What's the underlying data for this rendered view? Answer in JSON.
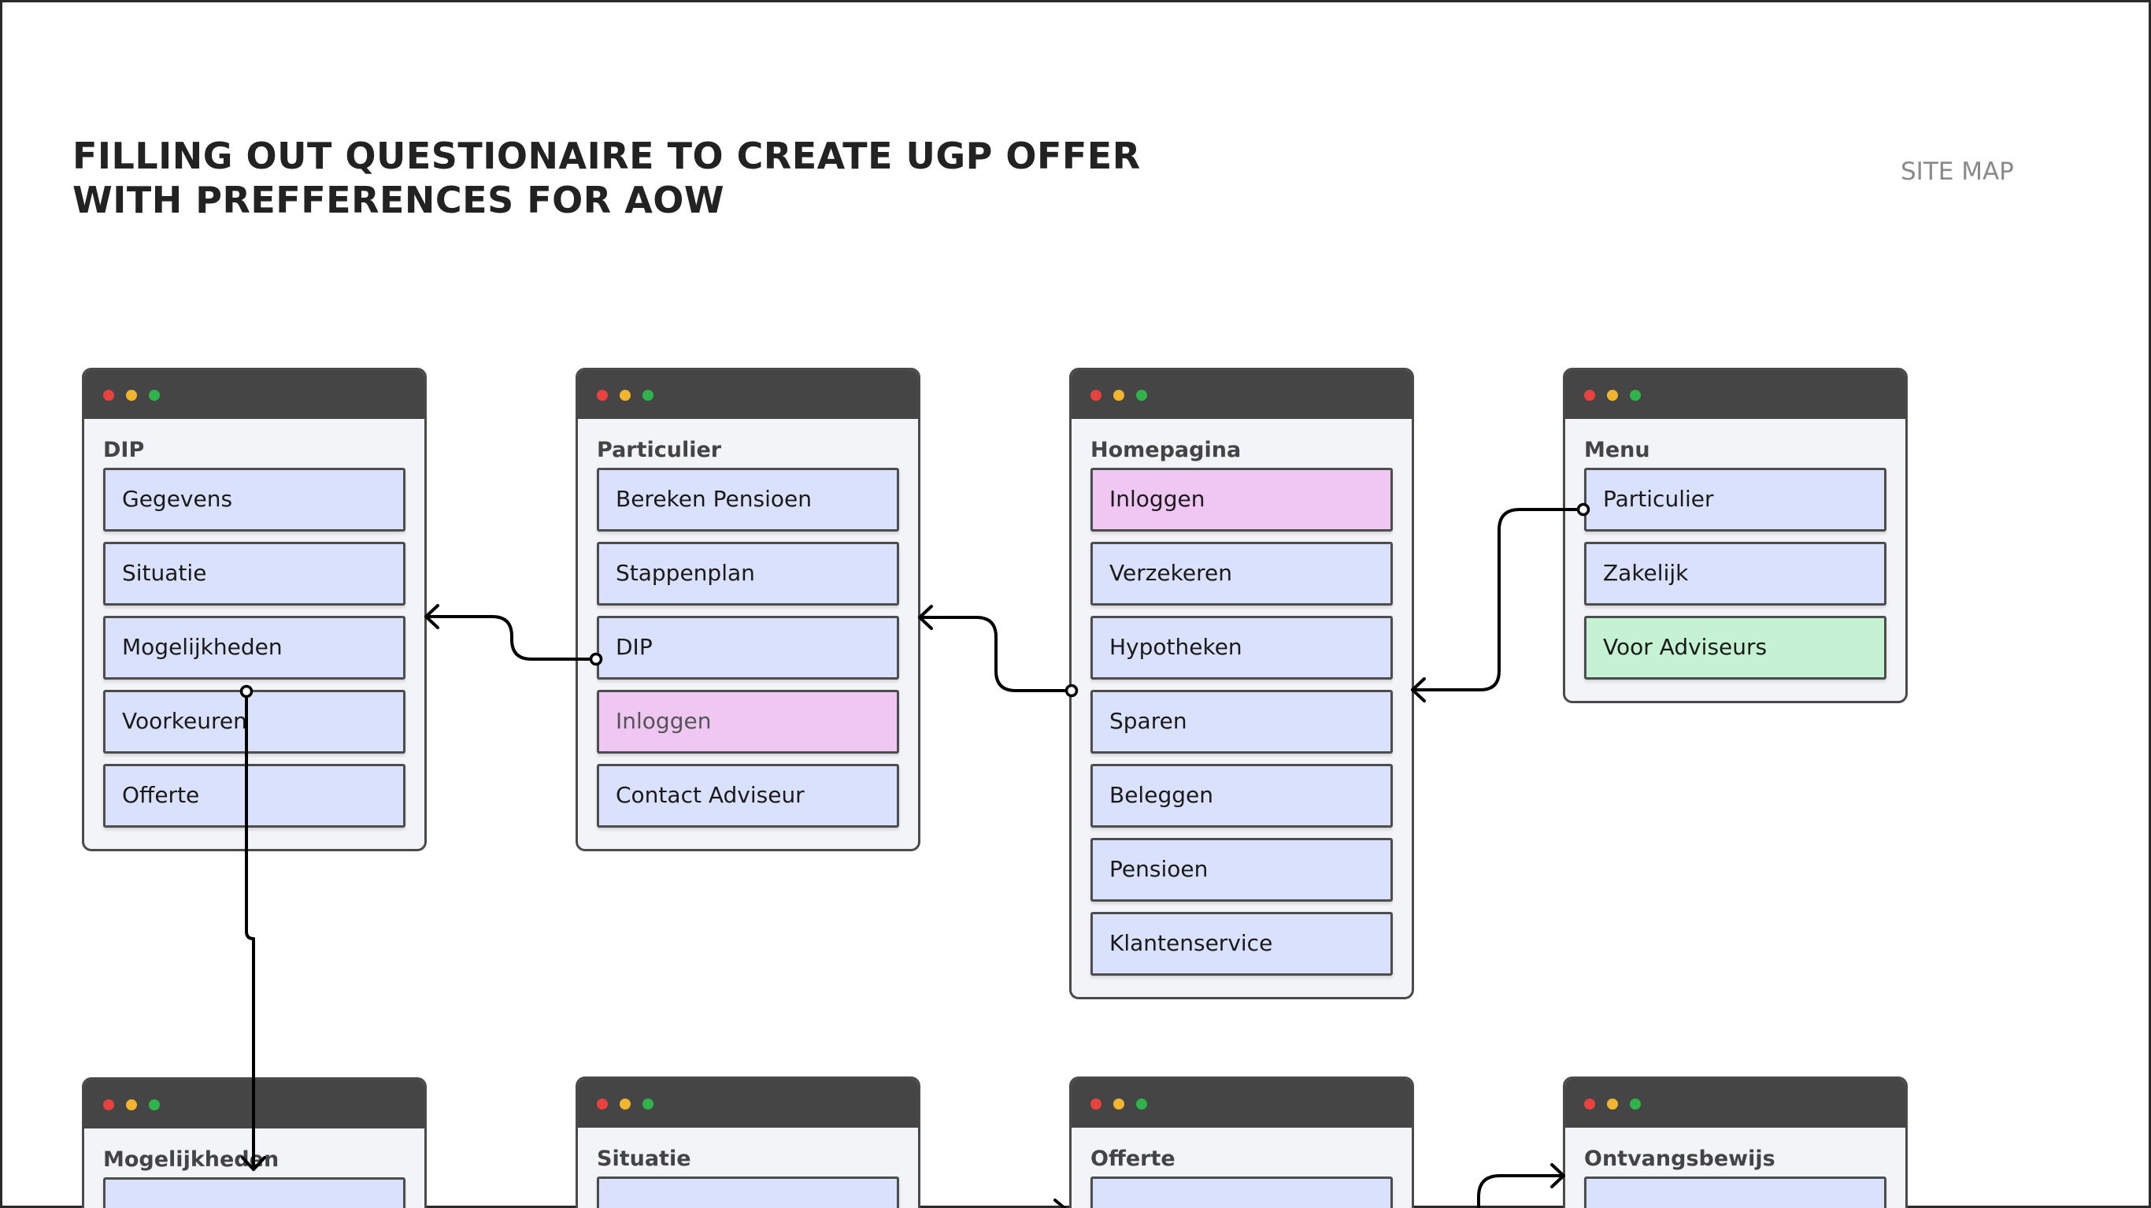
{
  "header": {
    "title_line1": "FILLING OUT QUESTIONAIRE TO CREATE UGP OFFER",
    "title_line2": "WITH PREFFERENCES FOR AOW",
    "section_label": "SITE MAP"
  },
  "windows": {
    "dip": {
      "title": "DIP",
      "items": [
        "Gegevens",
        "Situatie",
        "Mogelijkheden",
        "Voorkeuren",
        "Offerte"
      ]
    },
    "particulier": {
      "title": "Particulier",
      "items": [
        "Bereken Pensioen",
        "Stappenplan",
        "DIP",
        "Inloggen",
        "Contact Adviseur"
      ]
    },
    "homepagina": {
      "title": "Homepagina",
      "items": [
        "Inloggen",
        "Verzekeren",
        "Hypotheken",
        "Sparen",
        "Beleggen",
        "Pensioen",
        "Klantenservice"
      ]
    },
    "menu": {
      "title": "Menu",
      "items": [
        "Particulier",
        "Zakelijk",
        "Voor Adviseurs"
      ]
    },
    "mogelijkheden": {
      "title": "Mogelijkheden"
    },
    "situatie": {
      "title": "Situatie"
    },
    "offerte": {
      "title": "Offerte"
    },
    "ontvangsbewijs": {
      "title": "Ontvangsbewijs"
    }
  },
  "colors": {
    "item_default": "#dae1fd",
    "item_login": "#f0c6f3",
    "item_adviseurs": "#c4f2d3",
    "titlebar": "#454545"
  }
}
